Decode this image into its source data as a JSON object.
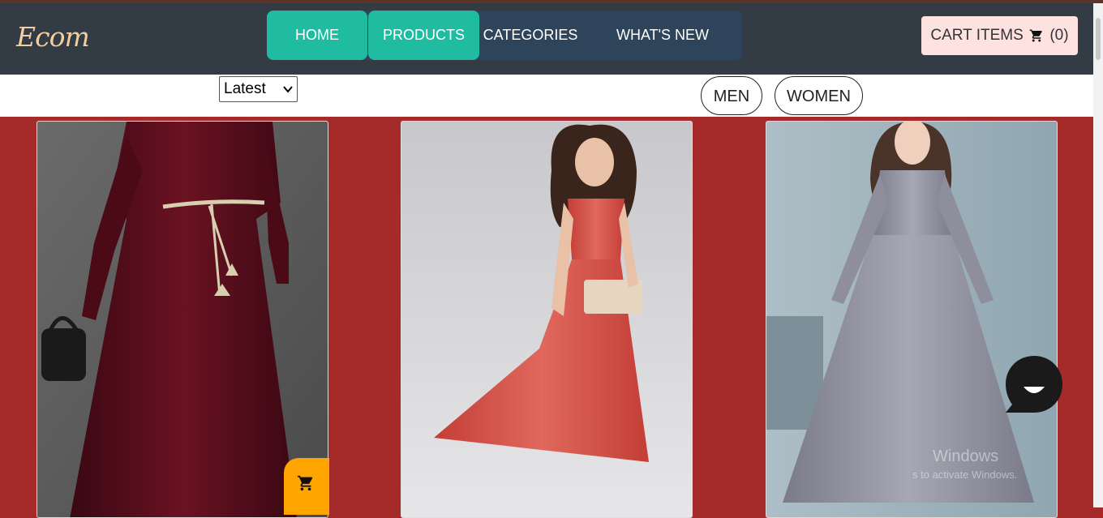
{
  "app": {
    "logo": "Ecom"
  },
  "nav": {
    "items": [
      {
        "label": "HOME",
        "active": true
      },
      {
        "label": "PRODUCTS",
        "active": true
      },
      {
        "label": "CATEGORIES",
        "active": false
      },
      {
        "label": "WHAT'S NEW",
        "active": false
      }
    ]
  },
  "cart": {
    "label": "CART ITEMS",
    "count": "(0)",
    "icon": "cart-icon"
  },
  "filters": {
    "sort_selected": "Latest",
    "gender": [
      "MEN",
      "WOMEN"
    ]
  },
  "products": [
    {
      "image": "maroon velvet long dress",
      "color": "#5a0f1c"
    },
    {
      "image": "red printed sleeveless maxi dress",
      "color": "#d9544a"
    },
    {
      "image": "grey lace long sleeve dress",
      "color": "#8c8c99"
    }
  ],
  "overlays": {
    "watermark_title": "Windows",
    "watermark_sub": "s to activate Windows."
  },
  "colors": {
    "navbar": "#333b45",
    "accent": "#1fbca1",
    "page": "#a52a2a",
    "fab": "#ffa400"
  }
}
